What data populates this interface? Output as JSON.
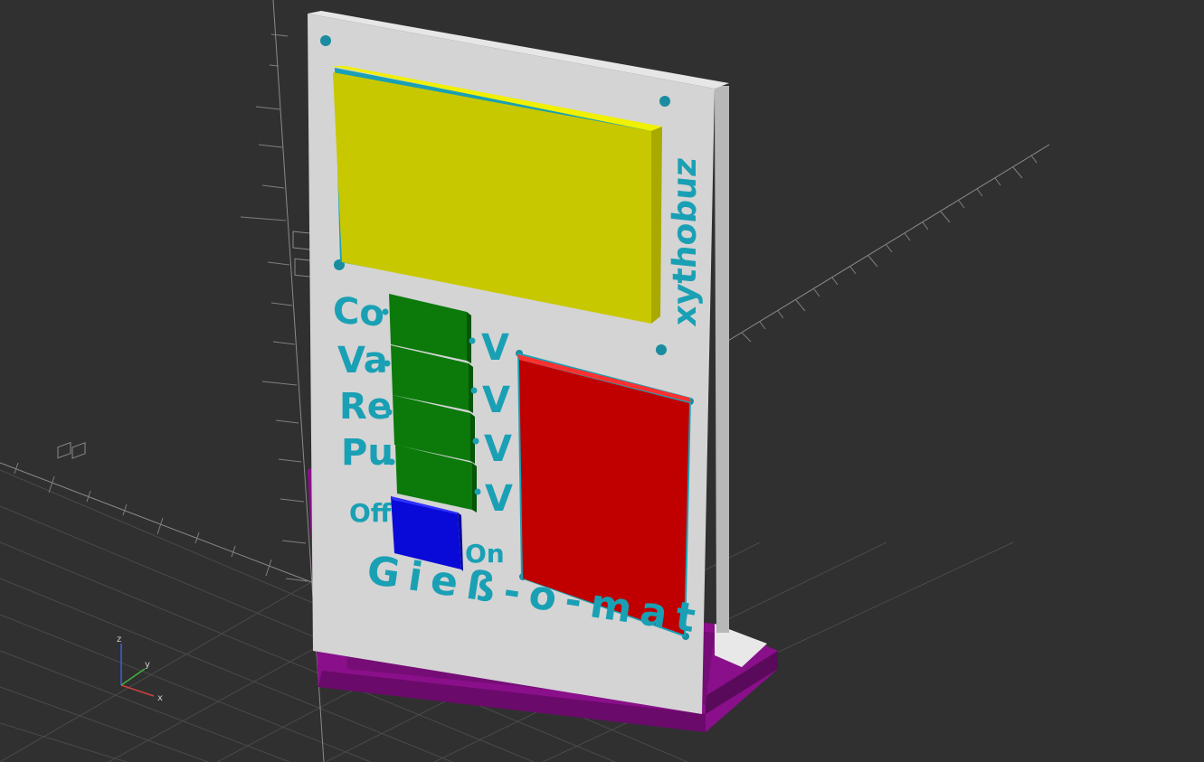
{
  "viewport": {
    "background": "#303030"
  },
  "model": {
    "title": "Gieß-o-mat",
    "brand": "xythobuz",
    "colors": {
      "panel_face": "#d4d4d4",
      "panel_edge": "#bdbdbd",
      "stand": "#8a0f8a",
      "stand_dark": "#6a0a6a",
      "display": "#c8c800",
      "display_top": "#f0f000",
      "indicator": "#c00000",
      "switch_green": "#0b7a0b",
      "switch_blue": "#0a0ad8",
      "label_teal": "#1aa0b4"
    },
    "channels": [
      {
        "label": "Co",
        "suffix": "V"
      },
      {
        "label": "Va",
        "suffix": "V"
      },
      {
        "label": "Re",
        "suffix": "V"
      },
      {
        "label": "Pu",
        "suffix": "V"
      }
    ],
    "power": {
      "off_label": "Off",
      "on_label": "On"
    }
  },
  "gizmo": {
    "x_label": "x",
    "y_label": "y",
    "z_label": "z",
    "x_color": "#d04040",
    "y_color": "#40b040",
    "z_color": "#4060d0"
  }
}
